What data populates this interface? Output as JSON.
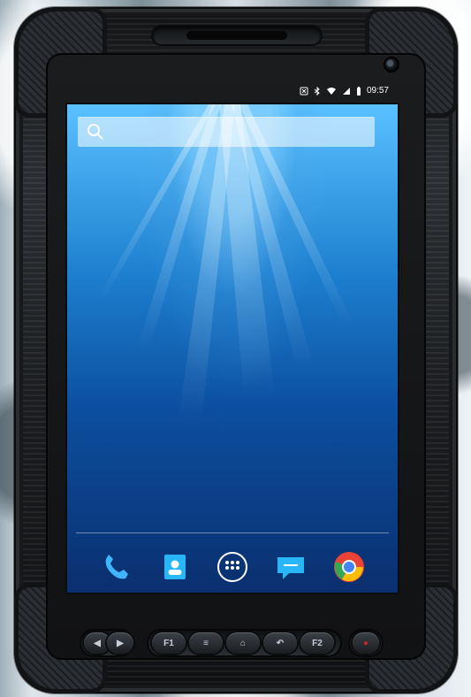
{
  "status_bar": {
    "time": "09:57",
    "icons": [
      "nfc-icon",
      "bluetooth-icon",
      "wifi-icon",
      "signal-icon",
      "battery-icon"
    ]
  },
  "search": {
    "placeholder": ""
  },
  "dock": [
    {
      "name": "phone-app",
      "icon": "phone-icon"
    },
    {
      "name": "contacts-app",
      "icon": "contacts-icon"
    },
    {
      "name": "app-drawer",
      "icon": "grid-icon"
    },
    {
      "name": "messaging-app",
      "icon": "message-icon"
    },
    {
      "name": "chrome-app",
      "icon": "chrome-icon"
    }
  ],
  "hardware_buttons": {
    "left": [
      "volume-down-icon",
      "volume-up-icon"
    ],
    "center": [
      "F1",
      "menu-icon",
      "home-icon",
      "back-icon",
      "F2"
    ],
    "right": [
      "power-icon"
    ]
  },
  "colors": {
    "device_body": "#1b1d20",
    "screen_top": "#5ac1ff",
    "screen_bottom": "#0a2f6e",
    "dock_blue": "#1e88e5",
    "chrome_red": "#ea4335",
    "chrome_yellow": "#fbbc05",
    "chrome_green": "#34a853"
  }
}
